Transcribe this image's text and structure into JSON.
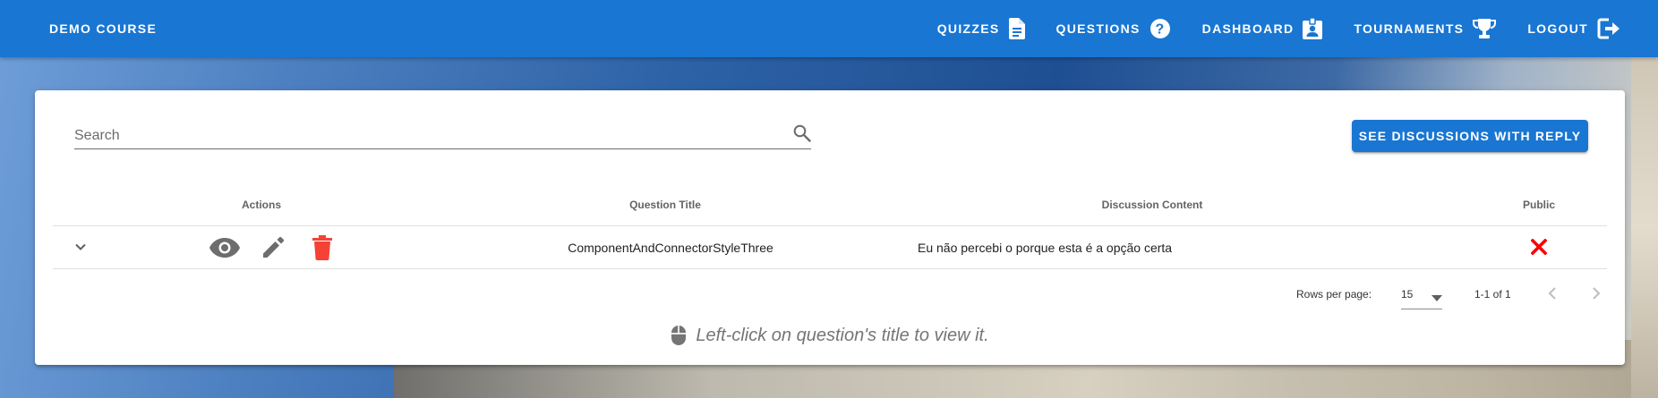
{
  "header": {
    "brand": "DEMO COURSE",
    "nav": [
      {
        "label": "QUIZZES",
        "icon": "file-document-icon"
      },
      {
        "label": "QUESTIONS",
        "icon": "help-circle-icon"
      },
      {
        "label": "DASHBOARD",
        "icon": "badge-account-icon"
      },
      {
        "label": "TOURNAMENTS",
        "icon": "trophy-icon"
      },
      {
        "label": "LOGOUT",
        "icon": "logout-icon"
      }
    ]
  },
  "search": {
    "placeholder": "Search",
    "value": ""
  },
  "actions": {
    "see_replies_label": "SEE DISCUSSIONS WITH REPLY"
  },
  "table": {
    "headers": [
      "Actions",
      "Question Title",
      "Discussion Content",
      "Public"
    ],
    "rows": [
      {
        "question_title": "ComponentAndConnectorStyleThree",
        "discussion_content": "Eu não percebi o porque esta é a opção certa",
        "public": false
      }
    ]
  },
  "pagination": {
    "rows_per_page_label": "Rows per page:",
    "rows_per_page": "15",
    "range": "1-1 of 1"
  },
  "hint": "Left-click on question's title to view it.",
  "colors": {
    "primary": "#1976d2",
    "danger": "#f44336",
    "public_false": "#f00"
  }
}
